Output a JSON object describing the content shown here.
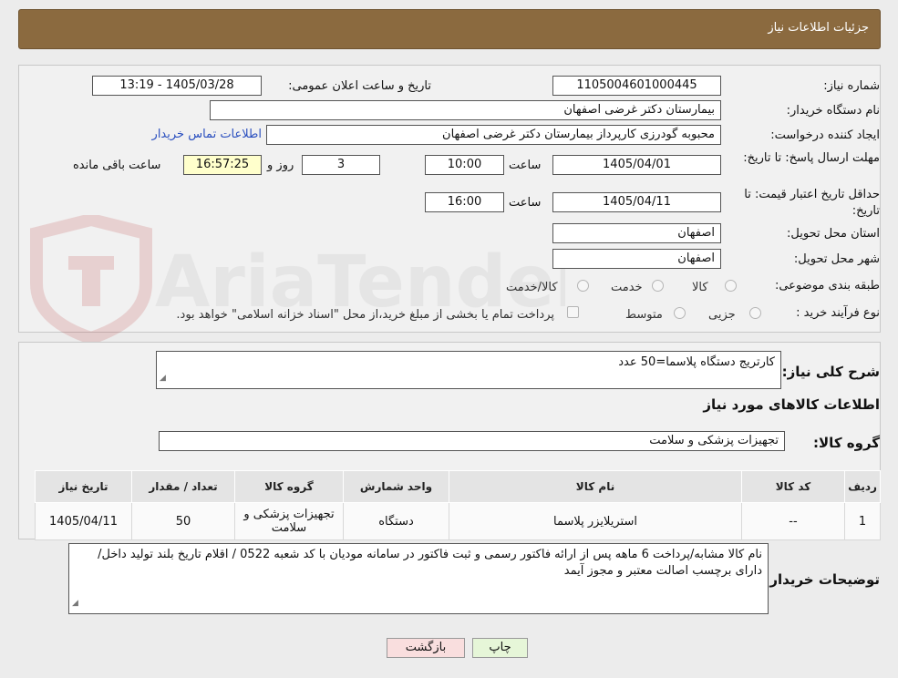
{
  "header": {
    "title": "جزئیات اطلاعات نیاز"
  },
  "watermark": {
    "text": "AriaTender.neT"
  },
  "form": {
    "need_number_label": "شماره نیاز:",
    "need_number": "1105004601000445",
    "announce_label": "تاریخ و ساعت اعلان عمومی:",
    "announce_value": "1405/03/28 - 13:19",
    "buyer_org_label": "نام دستگاه خریدار:",
    "buyer_org": "بیمارستان دکتر غرضی اصفهان",
    "creator_label": "ایجاد کننده درخواست:",
    "creator": "محبوبه گودرزی کارپرداز بیمارستان دکتر غرضی اصفهان",
    "contact_link": "اطلاعات تماس خریدار",
    "deadline_label": "مهلت ارسال پاسخ: تا تاریخ:",
    "deadline_date": "1405/04/01",
    "time_word": "ساعت",
    "deadline_time": "10:00",
    "days_value": "3",
    "days_word": "روز و",
    "remaining_time": "16:57:25",
    "remaining_word": "ساعت باقی مانده",
    "validity_label": "حداقل تاریخ اعتبار قیمت: تا تاریخ:",
    "validity_date": "1405/04/11",
    "validity_time": "16:00",
    "province_label": "استان محل تحویل:",
    "province": "اصفهان",
    "city_label": "شهر محل تحویل:",
    "city": "اصفهان",
    "category_label": "طبقه بندی موضوعی:",
    "category_options": [
      "کالا",
      "خدمت",
      "کالا/خدمت"
    ],
    "process_label": "نوع فرآیند خرید :",
    "process_options": [
      "جزیی",
      "متوسط"
    ],
    "payment_note": "پرداخت تمام یا بخشی از مبلغ خرید،از محل \"اسناد خزانه اسلامی\" خواهد بود."
  },
  "description": {
    "label": "شرح کلی نیاز:",
    "value": "کارتریج دستگاه پلاسما=50 عدد"
  },
  "goods_section": {
    "title": "اطلاعات کالاهای مورد نیاز",
    "group_label": "گروه کالا:",
    "group_value": "تجهیزات پزشکی و سلامت"
  },
  "table": {
    "headers": [
      "ردیف",
      "کد کالا",
      "نام کالا",
      "واحد شمارش",
      "گروه کالا",
      "تعداد / مقدار",
      "تاریخ نیاز"
    ],
    "rows": [
      [
        "1",
        "--",
        "استریلایزر پلاسما",
        "دستگاه",
        "تجهیزات پزشکی و سلامت",
        "50",
        "1405/04/11"
      ]
    ]
  },
  "buyer_notes": {
    "label": "توضیحات خریدار:",
    "value": "نام کالا مشابه/پرداخت 6 ماهه پس از ارائه فاکتور رسمی و ثبت فاکتور در سامانه مودیان با کد شعبه 0522 / اقلام تاریخ بلند تولید داخل/ دارای برچسب اصالت معتبر و مجوز آیمد"
  },
  "buttons": {
    "print": "چاپ",
    "back": "بازگشت"
  },
  "colors": {
    "header_bg": "#8b6a3f",
    "link": "#2a4fbf",
    "print_bg": "#e6f6d8",
    "back_bg": "#f9dede"
  }
}
